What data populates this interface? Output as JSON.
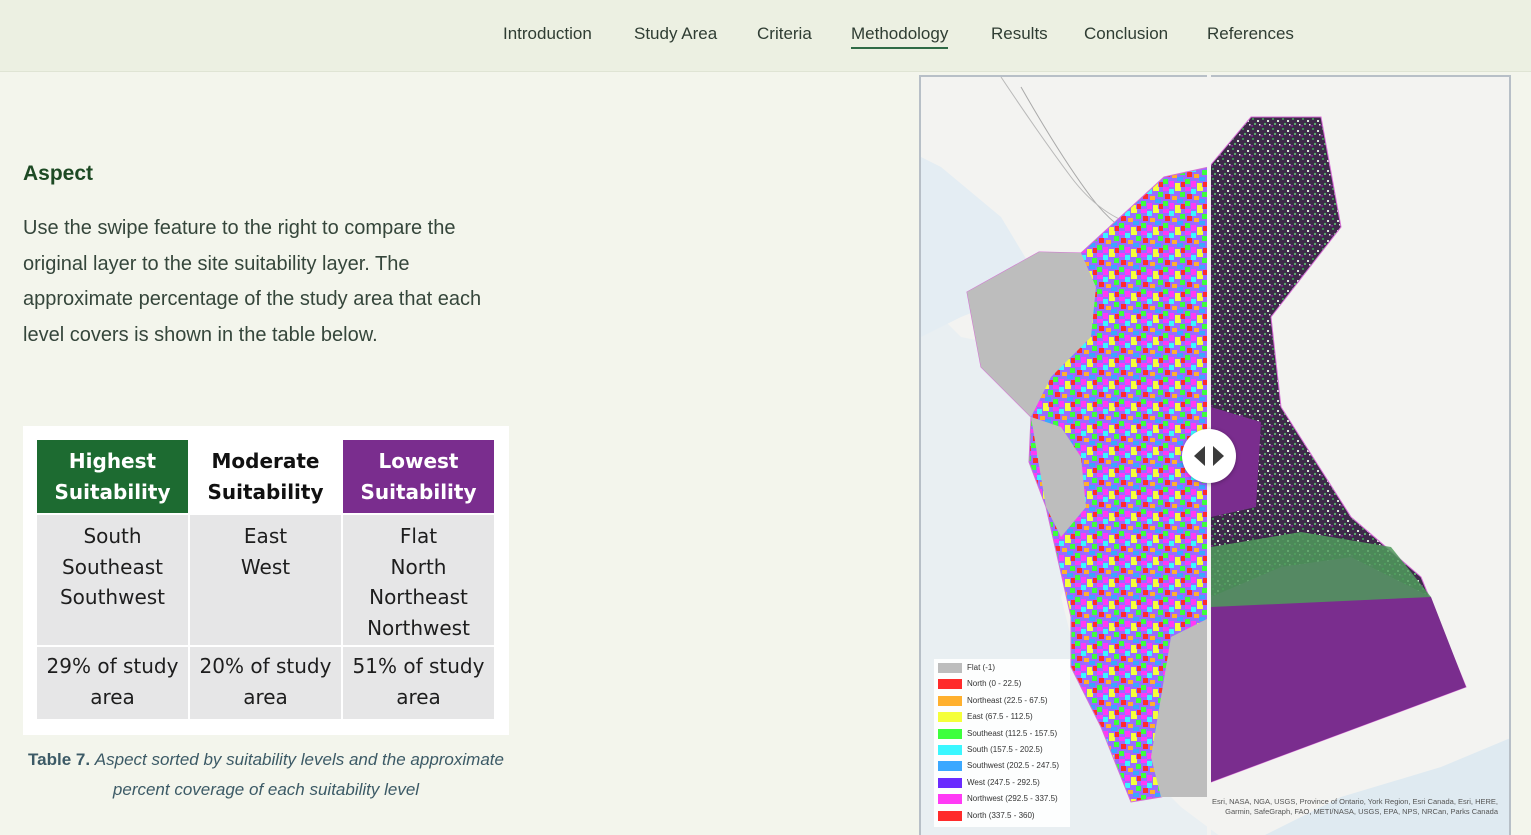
{
  "nav": {
    "items": [
      {
        "label": "Introduction"
      },
      {
        "label": "Study Area"
      },
      {
        "label": "Criteria"
      },
      {
        "label": "Methodology"
      },
      {
        "label": "Results"
      },
      {
        "label": "Conclusion"
      },
      {
        "label": "References"
      }
    ],
    "active": "Methodology"
  },
  "section": {
    "title": "Aspect",
    "body": "Use the swipe feature to the right to compare the original layer to the site suitability layer. The approximate percentage of the study area that each level covers is shown in the table below."
  },
  "table": {
    "headers": [
      "Highest Suitability",
      "Moderate Suitability",
      "Lowest Suitability"
    ],
    "header_colors": [
      "#1d6b31",
      "#ffffff",
      "#7a2d8e"
    ],
    "aspects": [
      [
        "South",
        "Southeast",
        "Southwest"
      ],
      [
        "East",
        "West"
      ],
      [
        "Flat",
        "North",
        "Northeast",
        "Northwest"
      ]
    ],
    "coverage": [
      "29% of study area",
      "20% of study area",
      "51% of study area"
    ]
  },
  "caption": {
    "label": "Table 7.",
    "text": "Aspect sorted by suitability levels and the approximate percent coverage of each suitability level"
  },
  "map": {
    "legend": [
      {
        "label": "Flat (-1)",
        "color": "#bdbdbd"
      },
      {
        "label": "North (0 - 22.5)",
        "color": "#ff2b2b"
      },
      {
        "label": "Northeast (22.5 - 67.5)",
        "color": "#ffb02e"
      },
      {
        "label": "East (67.5 - 112.5)",
        "color": "#f5ff3a"
      },
      {
        "label": "Southeast (112.5 - 157.5)",
        "color": "#3dff3d"
      },
      {
        "label": "South (157.5 - 202.5)",
        "color": "#3af7ff"
      },
      {
        "label": "Southwest (202.5 - 247.5)",
        "color": "#3aa8ff"
      },
      {
        "label": "West (247.5 - 292.5)",
        "color": "#6a2bff"
      },
      {
        "label": "Northwest (292.5 - 337.5)",
        "color": "#ff3af5"
      },
      {
        "label": "North (337.5 - 360)",
        "color": "#ff2b2b"
      }
    ],
    "attribution": "Esri, NASA, NGA, USGS, Province of Ontario, York Region, Esri Canada, Esri, HERE, Garmin, SafeGraph, FAO, METI/NASA, USGS, EPA, NPS, NRCan, Parks Canada",
    "suitability_colors": {
      "high": "#1d6b31",
      "low": "#7a2d8e"
    }
  }
}
